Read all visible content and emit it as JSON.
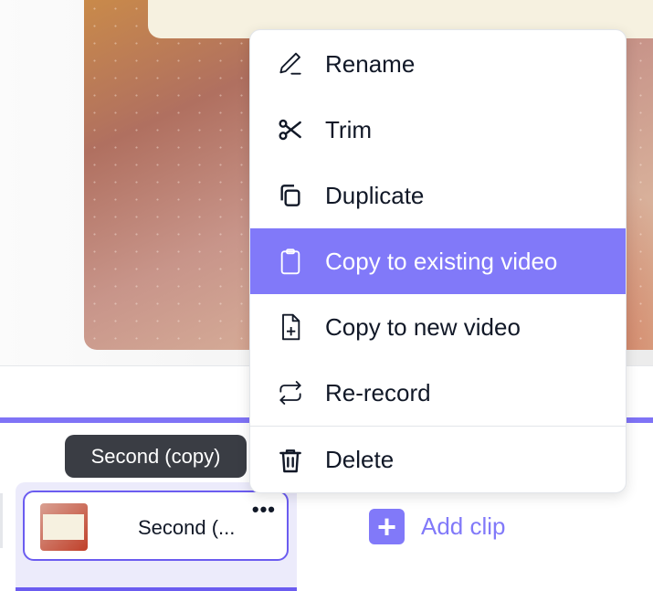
{
  "menu": {
    "items": [
      {
        "label": "Rename",
        "icon": "pencil-icon"
      },
      {
        "label": "Trim",
        "icon": "scissors-icon"
      },
      {
        "label": "Duplicate",
        "icon": "duplicate-icon"
      },
      {
        "label": "Copy to existing video",
        "icon": "clipboard-icon",
        "active": true
      },
      {
        "label": "Copy to new video",
        "icon": "file-plus-icon"
      },
      {
        "label": "Re-record",
        "icon": "repeat-icon"
      },
      {
        "label": "Delete",
        "icon": "trash-icon"
      }
    ]
  },
  "tooltip": "Second (copy)",
  "clip": {
    "title": "Second (...",
    "more": "•••"
  },
  "add_clip": {
    "label": "Add clip",
    "icon": "+"
  },
  "colors": {
    "accent": "#8179f9",
    "border": "#6b5cf0",
    "tooltip": "#3a3d44"
  }
}
